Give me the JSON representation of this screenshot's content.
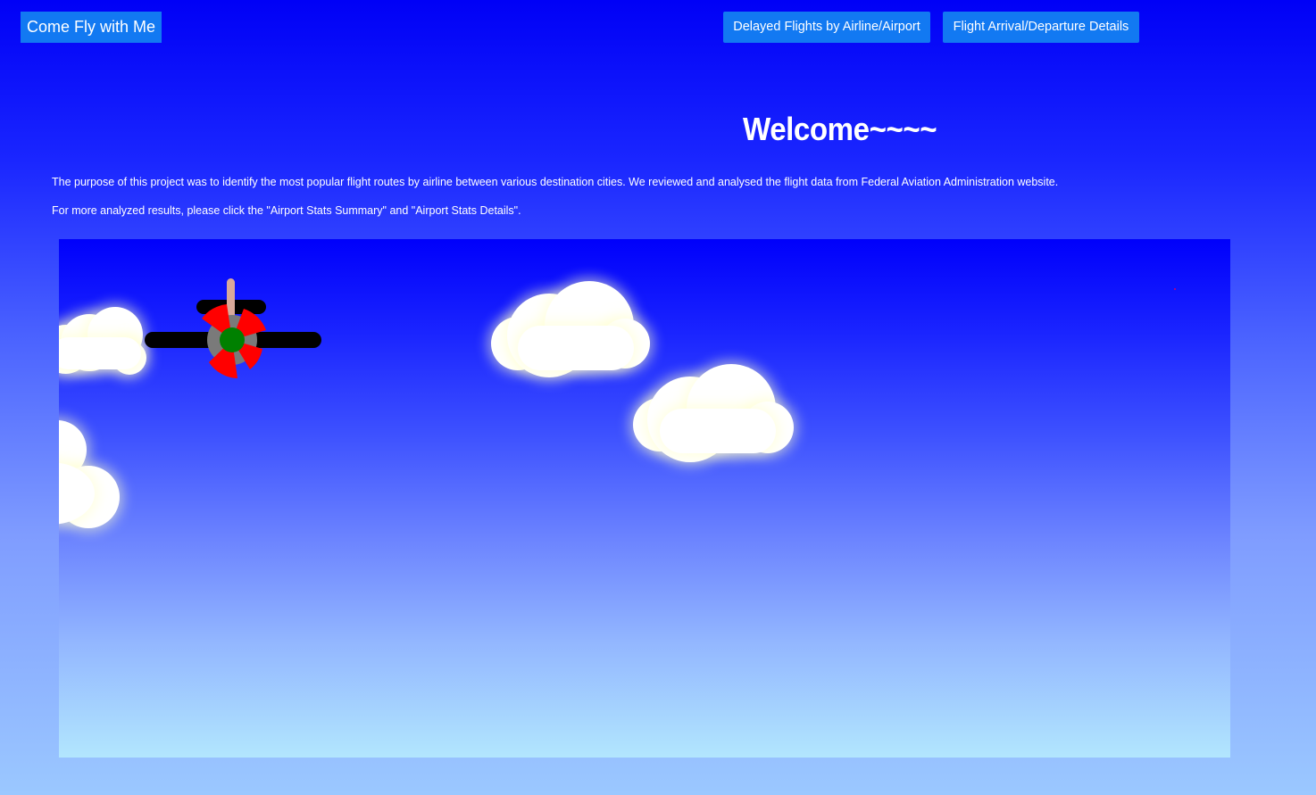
{
  "nav": {
    "brand": "Come Fly with Me",
    "buttons": [
      {
        "label": "Delayed Flights by Airline/Airport"
      },
      {
        "label": "Flight Arrival/Departure Details"
      }
    ]
  },
  "main": {
    "heading": "Welcome~~~~",
    "paragraphs": [
      "The purpose of this project was to identify the most popular flight routes by airline between various destination cities. We reviewed and analysed the flight data from Federal Aviation Administration website.",
      "For more analyzed results, please click the \"Airport Stats Summary\" and \"Airport Stats Details\"."
    ]
  },
  "colors": {
    "background_top": "#0000f6",
    "background_bottom": "#9bc8ff",
    "button": "#1279f2",
    "propeller": "#ff0000",
    "hub": "#008000",
    "wing": "#000000"
  },
  "icons": [
    "plane-icon",
    "cloud-icon"
  ]
}
